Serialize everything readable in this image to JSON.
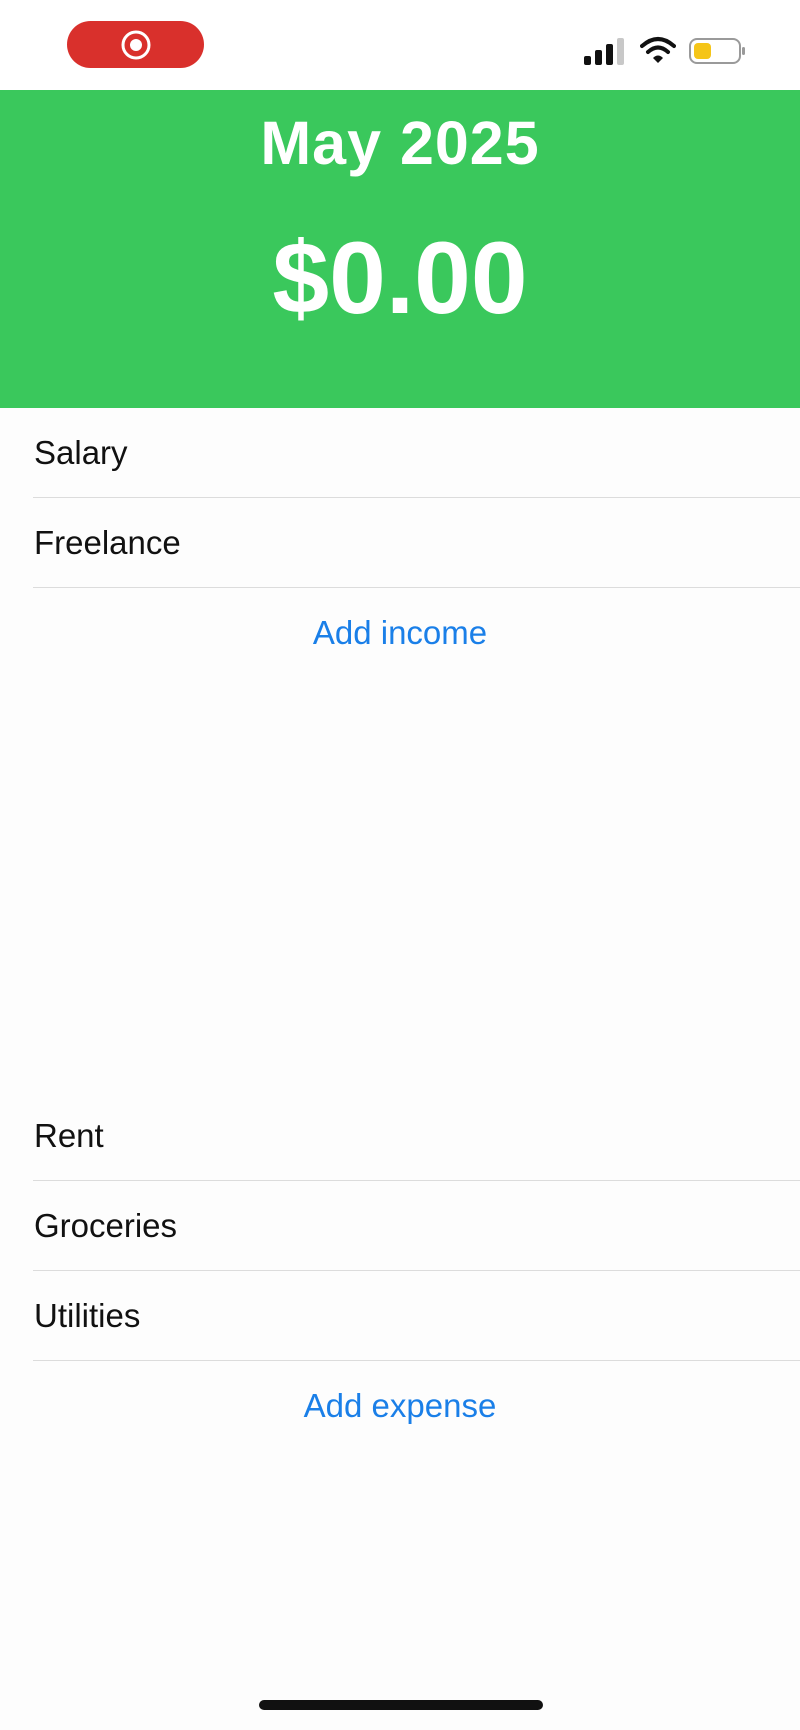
{
  "status_bar": {
    "record_icon": "screen-record-icon",
    "signal_icon": "cellular-signal-icon",
    "wifi_icon": "wifi-icon",
    "battery_icon": "battery-icon",
    "colors": {
      "record": "#d9302c",
      "battery_fill": "#f5c518"
    }
  },
  "header": {
    "month": "May 2025",
    "balance": "$0.00",
    "background": "#3ac85c"
  },
  "income": {
    "items": [
      {
        "label": "Salary"
      },
      {
        "label": "Freelance"
      }
    ],
    "add_label": "Add income"
  },
  "expenses": {
    "items": [
      {
        "label": "Rent"
      },
      {
        "label": "Groceries"
      },
      {
        "label": "Utilities"
      }
    ],
    "add_label": "Add expense"
  },
  "accent_color": "#1a7fe8"
}
